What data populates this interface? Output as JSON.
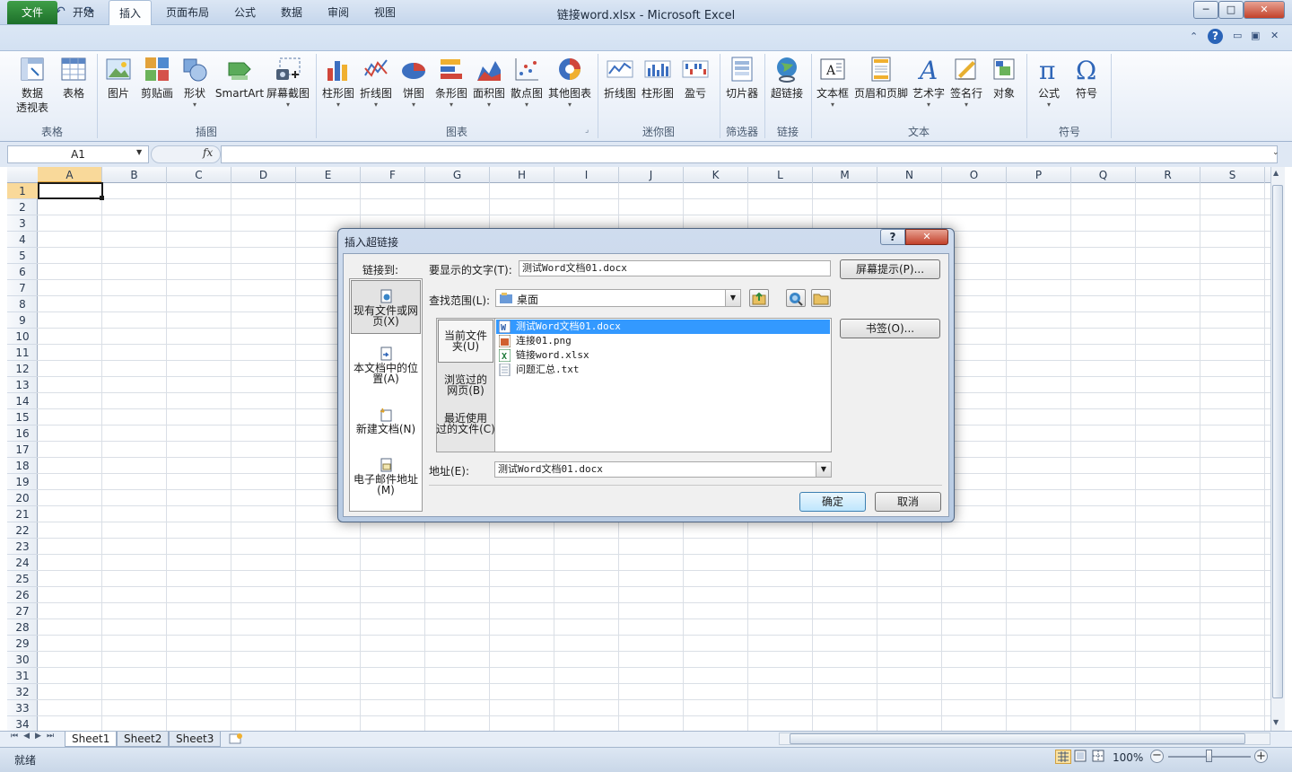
{
  "window": {
    "title": "链接word.xlsx - Microsoft Excel",
    "minimize": "─",
    "maximize": "□",
    "close": "✕",
    "ribbon_controls": [
      "⌃",
      "?",
      "▭",
      "▣",
      "✕"
    ]
  },
  "tabs": [
    {
      "label": "文件"
    },
    {
      "label": "开始"
    },
    {
      "label": "插入"
    },
    {
      "label": "页面布局"
    },
    {
      "label": "公式"
    },
    {
      "label": "数据"
    },
    {
      "label": "审阅"
    },
    {
      "label": "视图"
    }
  ],
  "ribbon": {
    "groups": {
      "table": "表格",
      "illustrations": "插图",
      "charts": "图表",
      "sparklines": "迷你图",
      "filter": "筛选器",
      "links": "链接",
      "text": "文本",
      "symbols": "符号"
    },
    "buttons": {
      "pivot": "数据",
      "pivot2": "透视表",
      "table": "表格",
      "picture": "图片",
      "clipart": "剪贴画",
      "shapes": "形状",
      "smartart": "SmartArt",
      "screenshot": "屏幕截图",
      "column": "柱形图",
      "line": "折线图",
      "pie": "饼图",
      "bar": "条形图",
      "area": "面积图",
      "scatter": "散点图",
      "other": "其他图表",
      "spark_line": "折线图",
      "spark_column": "柱形图",
      "winloss": "盈亏",
      "slicer": "切片器",
      "hyperlink": "超链接",
      "textbox": "文本框",
      "headerfooter": "页眉和页脚",
      "wordart": "艺术字",
      "signature": "签名行",
      "object": "对象",
      "equation": "公式",
      "symbol": "符号"
    },
    "dropdown_mark": "▾"
  },
  "formula_bar": {
    "name_box": "A1",
    "fx": "fx",
    "value": ""
  },
  "grid": {
    "columns": [
      "A",
      "B",
      "C",
      "D",
      "E",
      "F",
      "G",
      "H",
      "I",
      "J",
      "K",
      "L",
      "M",
      "N",
      "O",
      "P",
      "Q",
      "R",
      "S"
    ],
    "rows": [
      "1",
      "2",
      "3",
      "4",
      "5",
      "6",
      "7",
      "8",
      "9",
      "10",
      "11",
      "12",
      "13",
      "14",
      "15",
      "16",
      "17",
      "18",
      "19",
      "20",
      "21",
      "22",
      "23",
      "24",
      "25",
      "26",
      "27",
      "28",
      "29",
      "30",
      "31",
      "32",
      "33",
      "34"
    ]
  },
  "sheets": [
    {
      "label": "Sheet1"
    },
    {
      "label": "Sheet2"
    },
    {
      "label": "Sheet3"
    }
  ],
  "sheet_nav": [
    "⏮",
    "◀",
    "▶",
    "⏭"
  ],
  "status": {
    "ready": "就绪",
    "zoom": "100%",
    "zoom_minus": "−",
    "zoom_plus": "+"
  },
  "dialog": {
    "title": "插入超链接",
    "help": "?",
    "close": "✕",
    "link_to_label": "链接到:",
    "link_targets": [
      {
        "line1": "现有文件或网",
        "line2": "页(X)"
      },
      {
        "line1": "本文档中的位",
        "line2": "置(A)"
      },
      {
        "line1": "新建文档(N)",
        "line2": ""
      },
      {
        "line1": "电子邮件地址",
        "line2": "(M)"
      }
    ],
    "display_text_label": "要显示的文字(T):",
    "display_text_value": "测试Word文档01.docx",
    "screentip_button": "屏幕提示(P)...",
    "look_in_label": "查找范围(L):",
    "look_in_value": "桌面",
    "browse_tabs": [
      {
        "line1": "当前文件",
        "line2": "夹(U)"
      },
      {
        "line1": "浏览过的",
        "line2": "网页(B)"
      },
      {
        "line1": "最近使用",
        "line2": "过的文件(C)"
      }
    ],
    "files": [
      {
        "name": "测试Word文档01.docx"
      },
      {
        "name": "连接01.png"
      },
      {
        "name": "链接word.xlsx"
      },
      {
        "name": "问题汇总.txt"
      }
    ],
    "bookmark_button": "书签(O)...",
    "address_label": "地址(E):",
    "address_value": "测试Word文档01.docx",
    "ok_button": "确定",
    "cancel_button": "取消"
  }
}
